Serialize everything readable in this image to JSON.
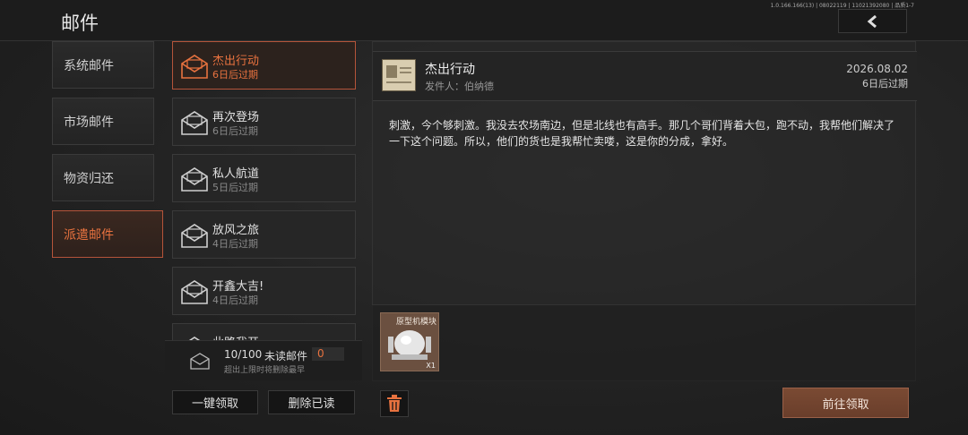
{
  "header": {
    "title": "邮件",
    "version": "1.0.166.166(13) | 08022119 | 11021392080 | 品质1-7",
    "back_icon": "chevron-left-icon"
  },
  "categories": [
    {
      "label": "系统邮件",
      "active": false
    },
    {
      "label": "市场邮件",
      "active": false
    },
    {
      "label": "物资归还",
      "active": false
    },
    {
      "label": "派遣邮件",
      "active": true
    }
  ],
  "mails": [
    {
      "title": "杰出行动",
      "expire": "6日后过期",
      "active": true
    },
    {
      "title": "再次登场",
      "expire": "6日后过期",
      "active": false
    },
    {
      "title": "私人航道",
      "expire": "5日后过期",
      "active": false
    },
    {
      "title": "放风之旅",
      "expire": "4日后过期",
      "active": false
    },
    {
      "title": "开鑫大吉!",
      "expire": "4日后过期",
      "active": false
    },
    {
      "title": "此路我开",
      "expire": "",
      "active": false
    }
  ],
  "counter": {
    "count": "10/100",
    "unread_label": "未读邮件",
    "unread_value": "0",
    "note": "超出上限时将删除最早"
  },
  "buttons": {
    "claim_all": "一键领取",
    "delete_read": "删除已读",
    "go_claim": "前往领取"
  },
  "detail": {
    "title": "杰出行动",
    "sender": "发件人：伯纳德",
    "date": "2026.08.02",
    "expire": "6日后过期",
    "body": "刺激，今个够刺激。我没去农场南边，但是北线也有高手。那几个哥们背着大包，跑不动，我帮他们解决了一下这个问题。所以，他们的货也是我帮忙卖喽，这是你的分成，拿好。"
  },
  "attachment": {
    "name": "原型机模块",
    "qty": "X1"
  },
  "colors": {
    "accent": "#e8723f",
    "accent_border": "#b5543a",
    "claim_button": "#6a3e2b"
  }
}
